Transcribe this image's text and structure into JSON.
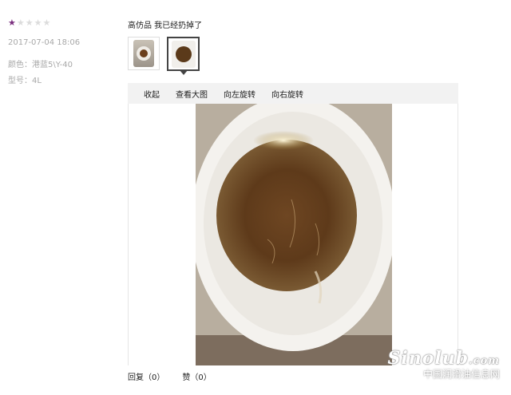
{
  "review": {
    "rating": 1,
    "max_rating": 5,
    "date": "2017-07-04 18:06",
    "color": "颜色：港蓝5\\Y-40",
    "model": "型号：4L",
    "comment": "高仿品 我已经扔掉了"
  },
  "toolbar": {
    "collapse": "收起",
    "view_large": "查看大图",
    "rotate_left": "向左旋转",
    "rotate_right": "向右旋转"
  },
  "footer": {
    "reply": "回复（0）",
    "like": "赞（0）"
  },
  "watermark": {
    "logo": "Sinolub",
    "domain": ".com",
    "text": "中国润滑油信息网"
  },
  "colors": {
    "star_on": "#7a2e7e",
    "star_off": "#dcdcdc",
    "toolbar_bg": "#f2f2f2"
  }
}
